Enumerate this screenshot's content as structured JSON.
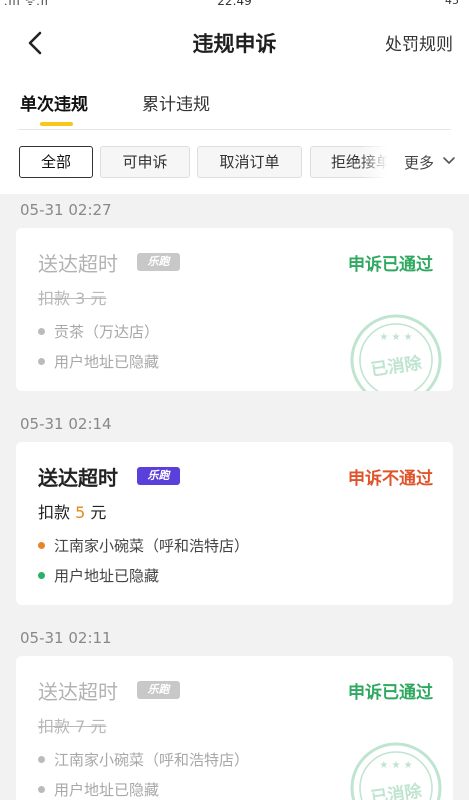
{
  "status_bar": {
    "time": "22:49",
    "signal": ".ııl ᯤ.ıl",
    "battery": "45"
  },
  "header": {
    "title": "违规申诉",
    "rules_link": "处罚规则"
  },
  "tabs": [
    {
      "label": "单次违规",
      "active": true
    },
    {
      "label": "累计违规",
      "active": false
    }
  ],
  "filters": {
    "chips": [
      "全部",
      "可申诉",
      "取消订单",
      "拒绝接单"
    ],
    "active_index": 0,
    "more_label": "更多"
  },
  "colors": {
    "accent_yellow": "#f7c71c",
    "pass_green": "#2fa860",
    "fail_red": "#e0542c",
    "fine_orange": "#e38a17",
    "badge_purple": "#5a3fdb"
  },
  "records": [
    {
      "time": "05-31 02:27",
      "title": "送达超时",
      "badge": "乐跑",
      "status": "申诉已通过",
      "fine_prefix": "扣款",
      "fine_amount": "3",
      "fine_unit": "元",
      "store": "贡茶（万达店）",
      "address": "用户地址已隐藏",
      "stamp_text": "已消除",
      "faded": true
    },
    {
      "time": "05-31 02:14",
      "title": "送达超时",
      "badge": "乐跑",
      "status": "申诉不通过",
      "fine_prefix": "扣款",
      "fine_amount": "5",
      "fine_unit": "元",
      "store": "江南家小碗菜（呼和浩特店）",
      "address": "用户地址已隐藏",
      "faded": false
    },
    {
      "time": "05-31 02:11",
      "title": "送达超时",
      "badge": "乐跑",
      "status": "申诉已通过",
      "fine_prefix": "扣款",
      "fine_amount": "7",
      "fine_unit": "元",
      "store": "江南家小碗菜（呼和浩特店）",
      "address": "用户地址已隐藏",
      "stamp_text": "已消除",
      "faded": true
    }
  ]
}
